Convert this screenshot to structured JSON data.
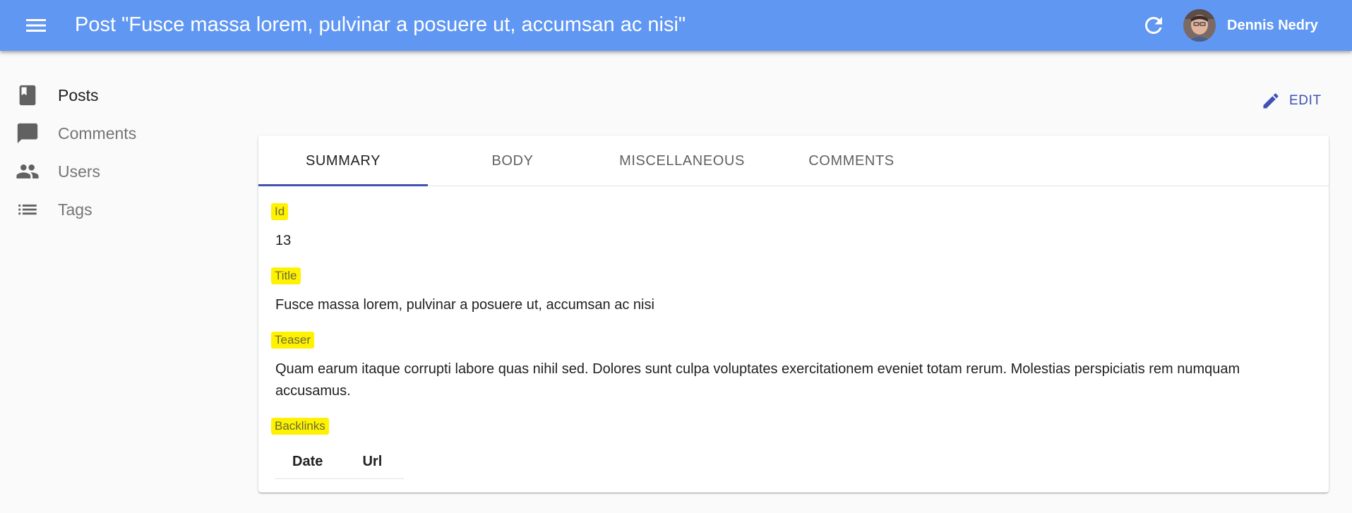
{
  "appbar": {
    "title": "Post \"Fusce massa lorem, pulvinar a posuere ut, accumsan ac nisi\"",
    "user_name": "Dennis Nedry",
    "color": "#6097f2",
    "menu_icon": "menu-icon",
    "refresh_icon": "refresh-icon"
  },
  "sidebar": {
    "items": [
      {
        "label": "Posts",
        "icon": "book-icon",
        "active": true
      },
      {
        "label": "Comments",
        "icon": "comment-icon",
        "active": false
      },
      {
        "label": "Users",
        "icon": "people-icon",
        "active": false
      },
      {
        "label": "Tags",
        "icon": "list-icon",
        "active": false
      }
    ]
  },
  "actions": {
    "edit_label": "EDIT",
    "edit_icon": "pencil-icon",
    "accent": "#3f51b5"
  },
  "tabs": [
    {
      "label": "SUMMARY",
      "active": true
    },
    {
      "label": "BODY",
      "active": false
    },
    {
      "label": "MISCELLANEOUS",
      "active": false
    },
    {
      "label": "COMMENTS",
      "active": false
    }
  ],
  "fields": {
    "id": {
      "label": "Id",
      "value": "13"
    },
    "title": {
      "label": "Title",
      "value": "Fusce massa lorem, pulvinar a posuere ut, accumsan ac nisi"
    },
    "teaser": {
      "label": "Teaser",
      "value": "Quam earum itaque corrupti labore quas nihil sed. Dolores sunt culpa voluptates exercitationem eveniet totam rerum. Molestias perspiciatis rem numquam accusamus."
    },
    "backlinks": {
      "label": "Backlinks",
      "columns": [
        "Date",
        "Url"
      ]
    }
  },
  "highlight_color": "#fff200"
}
